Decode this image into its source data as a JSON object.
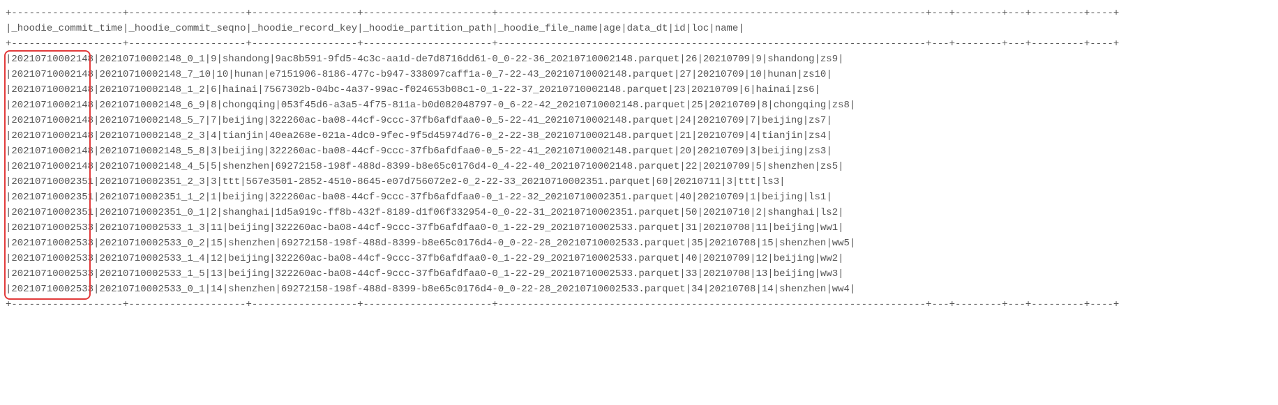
{
  "chart_data": {
    "type": "table",
    "title": "",
    "columns": [
      "_hoodie_commit_time",
      "_hoodie_commit_seqno",
      "_hoodie_record_key",
      "_hoodie_partition_path",
      "_hoodie_file_name",
      "age",
      "data_dt",
      "id",
      "loc",
      "name"
    ],
    "rows": [
      [
        "20210710002148",
        "20210710002148_0_1",
        "9",
        "shandong",
        "9ac8b591-9fd5-4c3c-aa1d-de7d8716dd61-0_0-22-36_20210710002148.parquet",
        "26",
        "20210709",
        "9",
        "shandong",
        "zs9"
      ],
      [
        "20210710002148",
        "20210710002148_7_10",
        "10",
        "hunan",
        "e7151906-8186-477c-b947-338097caff1a-0_7-22-43_20210710002148.parquet",
        "27",
        "20210709",
        "10",
        "hunan",
        "zs10"
      ],
      [
        "20210710002148",
        "20210710002148_1_2",
        "6",
        "hainai",
        "7567302b-04bc-4a37-99ac-f024653b08c1-0_1-22-37_20210710002148.parquet",
        "23",
        "20210709",
        "6",
        "hainai",
        "zs6"
      ],
      [
        "20210710002148",
        "20210710002148_6_9",
        "8",
        "chongqing",
        "053f45d6-a3a5-4f75-811a-b0d082048797-0_6-22-42_20210710002148.parquet",
        "25",
        "20210709",
        "8",
        "chongqing",
        "zs8"
      ],
      [
        "20210710002148",
        "20210710002148_5_7",
        "7",
        "beijing",
        "322260ac-ba08-44cf-9ccc-37fb6afdfaa0-0_5-22-41_20210710002148.parquet",
        "24",
        "20210709",
        "7",
        "beijing",
        "zs7"
      ],
      [
        "20210710002148",
        "20210710002148_2_3",
        "4",
        "tianjin",
        "40ea268e-021a-4dc0-9fec-9f5d45974d76-0_2-22-38_20210710002148.parquet",
        "21",
        "20210709",
        "4",
        "tianjin",
        "zs4"
      ],
      [
        "20210710002148",
        "20210710002148_5_8",
        "3",
        "beijing",
        "322260ac-ba08-44cf-9ccc-37fb6afdfaa0-0_5-22-41_20210710002148.parquet",
        "20",
        "20210709",
        "3",
        "beijing",
        "zs3"
      ],
      [
        "20210710002148",
        "20210710002148_4_5",
        "5",
        "shenzhen",
        "69272158-198f-488d-8399-b8e65c0176d4-0_4-22-40_20210710002148.parquet",
        "22",
        "20210709",
        "5",
        "shenzhen",
        "zs5"
      ],
      [
        "20210710002351",
        "20210710002351_2_3",
        "3",
        "ttt",
        "567e3501-2852-4510-8645-e07d756072e2-0_2-22-33_20210710002351.parquet",
        "60",
        "20210711",
        "3",
        "ttt",
        "ls3"
      ],
      [
        "20210710002351",
        "20210710002351_1_2",
        "1",
        "beijing",
        "322260ac-ba08-44cf-9ccc-37fb6afdfaa0-0_1-22-32_20210710002351.parquet",
        "40",
        "20210709",
        "1",
        "beijing",
        "ls1"
      ],
      [
        "20210710002351",
        "20210710002351_0_1",
        "2",
        "shanghai",
        "1d5a919c-ff8b-432f-8189-d1f06f332954-0_0-22-31_20210710002351.parquet",
        "50",
        "20210710",
        "2",
        "shanghai",
        "ls2"
      ],
      [
        "20210710002533",
        "20210710002533_1_3",
        "11",
        "beijing",
        "322260ac-ba08-44cf-9ccc-37fb6afdfaa0-0_1-22-29_20210710002533.parquet",
        "31",
        "20210708",
        "11",
        "beijing",
        "ww1"
      ],
      [
        "20210710002533",
        "20210710002533_0_2",
        "15",
        "shenzhen",
        "69272158-198f-488d-8399-b8e65c0176d4-0_0-22-28_20210710002533.parquet",
        "35",
        "20210708",
        "15",
        "shenzhen",
        "ww5"
      ],
      [
        "20210710002533",
        "20210710002533_1_4",
        "12",
        "beijing",
        "322260ac-ba08-44cf-9ccc-37fb6afdfaa0-0_1-22-29_20210710002533.parquet",
        "40",
        "20210709",
        "12",
        "beijing",
        "ww2"
      ],
      [
        "20210710002533",
        "20210710002533_1_5",
        "13",
        "beijing",
        "322260ac-ba08-44cf-9ccc-37fb6afdfaa0-0_1-22-29_20210710002533.parquet",
        "33",
        "20210708",
        "13",
        "beijing",
        "ww3"
      ],
      [
        "20210710002533",
        "20210710002533_0_1",
        "14",
        "shenzhen",
        "69272158-198f-488d-8399-b8e65c0176d4-0_0-22-28_20210710002533.parquet",
        "34",
        "20210708",
        "14",
        "shenzhen",
        "ww4"
      ]
    ]
  },
  "col_widths_ch": [
    19,
    20,
    18,
    22,
    73,
    3,
    8,
    3,
    9,
    4
  ],
  "highlight": {
    "col_index": 0,
    "row_start": 0,
    "row_count": 16
  }
}
